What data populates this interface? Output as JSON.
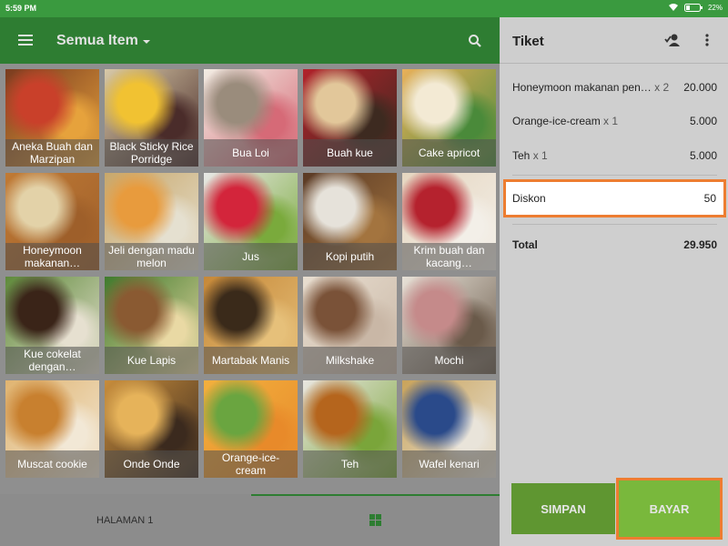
{
  "status_bar": {
    "time": "5:59 PM",
    "battery": "22%"
  },
  "header": {
    "title": "Semua Item"
  },
  "items": [
    {
      "label": "Aneka Buah dan Marzipan",
      "colors": [
        "#7a3b1f",
        "#c9402a",
        "#e6a23c"
      ]
    },
    {
      "label": "Black Sticky Rice Porridge",
      "colors": [
        "#d8c9a8",
        "#f1c232",
        "#4a2c2a"
      ]
    },
    {
      "label": "Bua Loi",
      "colors": [
        "#f2ede4",
        "#9a8c7c",
        "#d66a77"
      ]
    },
    {
      "label": "Buah kue",
      "colors": [
        "#b2222b",
        "#e2c79a",
        "#3d2a20"
      ]
    },
    {
      "label": "Cake apricot",
      "colors": [
        "#e8b05a",
        "#f3ead4",
        "#4a8a3a"
      ]
    },
    {
      "label": "Honeymoon makanan…",
      "colors": [
        "#c07a35",
        "#e3d2a8",
        "#9e5f2a"
      ]
    },
    {
      "label": "Jeli dengan madu melon",
      "colors": [
        "#c8a76a",
        "#e89b3d",
        "#e5e0d0"
      ]
    },
    {
      "label": "Jus",
      "colors": [
        "#e8e8e6",
        "#d3253b",
        "#7aaa3c"
      ]
    },
    {
      "label": "Kopi putih",
      "colors": [
        "#5a3a25",
        "#e6e2da",
        "#a3743f"
      ]
    },
    {
      "label": "Krim buah dan kacang…",
      "colors": [
        "#e5d6c0",
        "#b5222e",
        "#f3efe8"
      ]
    },
    {
      "label": "Kue cokelat dengan…",
      "colors": [
        "#5e8a3a",
        "#3a2418",
        "#e6e0d0"
      ]
    },
    {
      "label": "Kue Lapis",
      "colors": [
        "#3f7a2c",
        "#8a5a32",
        "#e9d9a4"
      ]
    },
    {
      "label": "Martabak Manis",
      "colors": [
        "#c68838",
        "#3a2a1a",
        "#e6c07a"
      ]
    },
    {
      "label": "Milkshake",
      "colors": [
        "#e8ded0",
        "#7a5238",
        "#c9b7a6"
      ]
    },
    {
      "label": "Mochi",
      "colors": [
        "#e8e2d8",
        "#c58a8a",
        "#6a5a4a"
      ]
    },
    {
      "label": "Muscat cookie",
      "colors": [
        "#e0b470",
        "#c8802f",
        "#f2e8d6"
      ]
    },
    {
      "label": "Onde Onde",
      "colors": [
        "#c88d3c",
        "#e6b35a",
        "#3b2a1e"
      ]
    },
    {
      "label": "Orange-ice-cream",
      "colors": [
        "#f2b03e",
        "#6aa540",
        "#e88a2a"
      ]
    },
    {
      "label": "Teh",
      "colors": [
        "#e9e6e0",
        "#b5651d",
        "#7aa53a"
      ]
    },
    {
      "label": "Wafel kenari",
      "colors": [
        "#c9a35a",
        "#2a4a8a",
        "#e9e4da"
      ]
    }
  ],
  "footer": {
    "page_label": "HALAMAN 1"
  },
  "ticket": {
    "title": "Tiket",
    "lines": [
      {
        "name": "Honeymoon makanan pen…",
        "qty": "x 2",
        "value": "20.000"
      },
      {
        "name": "Orange-ice-cream",
        "qty": "x 1",
        "value": "5.000"
      },
      {
        "name": "Teh",
        "qty": "x 1",
        "value": "5.000"
      }
    ],
    "discount": {
      "label": "Diskon",
      "value": "50"
    },
    "total": {
      "label": "Total",
      "value": "29.950"
    },
    "save_label": "SIMPAN",
    "pay_label": "BAYAR"
  },
  "colors": {
    "brand_dark": "#2e7d32",
    "brand_light": "#79b83c",
    "highlight": "#ed7d31"
  }
}
